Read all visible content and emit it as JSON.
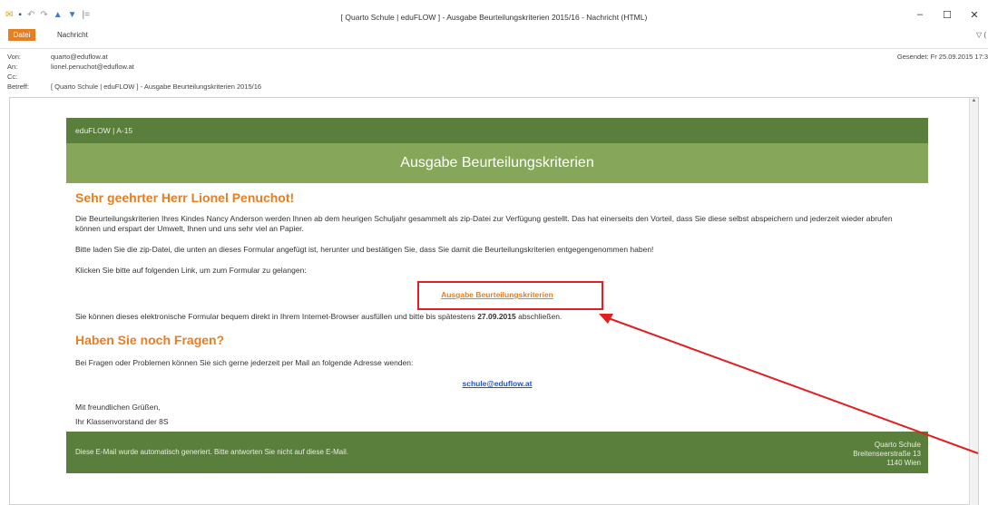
{
  "window": {
    "title": "[ Quarto Schule | eduFLOW ] - Ausgabe Beurteilungskriterien 2015/16 - Nachricht (HTML)",
    "minimize": "–",
    "maximize": "☐",
    "close": "✕"
  },
  "quick_access": [
    "save-icon",
    "undo-icon",
    "redo-icon",
    "up-icon",
    "down-icon",
    "customize-icon"
  ],
  "tabs": {
    "file": "Datei",
    "message": "Nachricht",
    "right_icon": "▽ ("
  },
  "headers": {
    "from_label": "Von:",
    "from_value": "quarto@eduflow.at",
    "to_label": "An:",
    "to_value": "lionel.penuchot@eduflow.at",
    "cc_label": "Cc:",
    "cc_value": "",
    "subject_label": "Betreff:",
    "subject_value": "[ Quarto Schule | eduFLOW ] - Ausgabe Beurteilungskriterien 2015/16",
    "sent_label": "Gesendet:",
    "sent_value": "Fr 25.09.2015 17:3"
  },
  "mail": {
    "top_strip": "eduFLOW | A-15",
    "banner": "Ausgabe Beurteilungskriterien",
    "greeting": "Sehr geehrter Herr Lionel Penuchot!",
    "p1": "Die Beurteilungskriterien Ihres Kindes Nancy Anderson werden Ihnen ab dem heurigen Schuljahr gesammelt als zip-Datei zur Verfügung gestellt. Das hat einerseits den Vorteil, dass Sie diese selbst abspeichern und jederzeit wieder abrufen können und erspart der Umwelt, Ihnen und uns sehr viel an Papier.",
    "p2": "Bitte laden Sie die zip-Datei, die unten an dieses Formular angefügt ist, herunter und bestätigen Sie, dass Sie damit die Beurteilungskriterien entgegengenommen haben!",
    "p3": "Klicken Sie bitte auf folgenden Link, um zum Formular zu gelangen:",
    "form_link": "Ausgabe Beurteilungskriterien",
    "p4_before": "Sie können dieses elektronische Formular bequem direkt in Ihrem Internet-Browser ausfüllen und bitte bis spätestens ",
    "p4_date": "27.09.2015",
    "p4_after": " abschließen.",
    "h2": "Haben Sie noch Fragen?",
    "p5": "Bei Fragen oder Problemen können Sie sich gerne jederzeit per Mail an folgende Adresse wenden:",
    "email": "schule@eduflow.at",
    "sig1": "Mit freundlichen Grüßen,",
    "sig2": "Ihr Klassenvorstand der 8S",
    "footer_left": "Diese E-Mail wurde automatisch generiert. Bitte antworten Sie nicht auf diese E-Mail.",
    "footer_r1": "Quarto Schule",
    "footer_r2": "Breitenseerstraße 13",
    "footer_r3": "1140 Wien"
  },
  "colors": {
    "accent": "#e67e22",
    "dark_green": "#5a7f3c",
    "light_green": "#86a65a",
    "highlight": "#e02020"
  }
}
